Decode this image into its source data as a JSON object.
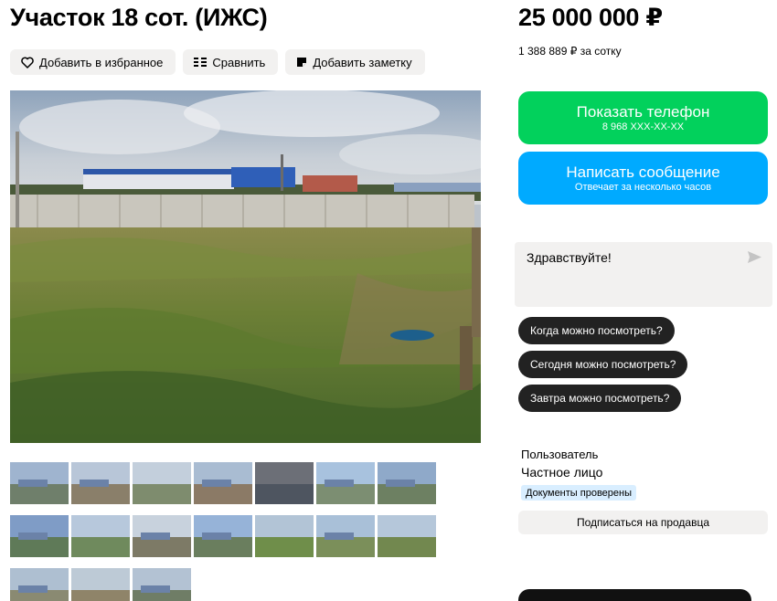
{
  "listing": {
    "title": "Участок 18 сот. (ИЖС)",
    "price": "25 000 000 ₽",
    "price_per_unit": "1 388 889 ₽ за сотку"
  },
  "actions": {
    "favorite": "Добавить в избранное",
    "compare": "Сравнить",
    "note": "Добавить заметку"
  },
  "contact": {
    "show_phone": "Показать телефон",
    "phone_masked": "8 968 XXX-XX-XX",
    "write_message": "Написать сообщение",
    "reply_time": "Отвечает за несколько часов"
  },
  "chat": {
    "draft_text": "Здравствуйте!",
    "quick_replies": [
      "Когда можно посмотреть?",
      "Сегодня можно посмотреть?",
      "Завтра можно посмотреть?"
    ]
  },
  "seller": {
    "role": "Пользователь",
    "type": "Частное лицо",
    "verified_badge": "Документы проверены",
    "subscribe": "Подписаться на продавца"
  },
  "gallery": {
    "thumbnail_count": 17,
    "active_index": 11,
    "thumbs": [
      {
        "sky": "#9fb4cf",
        "ground": "#6f7f6b",
        "building": true
      },
      {
        "sky": "#b8c6d8",
        "ground": "#8a7f6a",
        "building": true
      },
      {
        "sky": "#c3cfdc",
        "ground": "#7e8c6e",
        "building": false
      },
      {
        "sky": "#a9bcd2",
        "ground": "#8b7a66",
        "building": true
      },
      {
        "sky": "#6c6f77",
        "ground": "#4e5560",
        "building": false
      },
      {
        "sky": "#a8c2de",
        "ground": "#7c8e72",
        "building": true
      },
      {
        "sky": "#8fa9c9",
        "ground": "#6d8062",
        "building": true
      },
      {
        "sky": "#7f9cc6",
        "ground": "#5f7a58",
        "building": true
      },
      {
        "sky": "#b7c8dc",
        "ground": "#6f8a5d",
        "building": false
      },
      {
        "sky": "#c8d2dd",
        "ground": "#7d7a66",
        "building": true
      },
      {
        "sky": "#96b3d8",
        "ground": "#6a7e5e",
        "building": true
      },
      {
        "sky": "#b2c4d6",
        "ground": "#6f8e4a",
        "building": false
      },
      {
        "sky": "#a9c0d8",
        "ground": "#7b8f5a",
        "building": true
      },
      {
        "sky": "#b5c7da",
        "ground": "#72884f",
        "building": false
      },
      {
        "sky": "#aebfd1",
        "ground": "#8a8a72",
        "building": true
      },
      {
        "sky": "#bdcad6",
        "ground": "#8f8469",
        "building": false
      },
      {
        "sky": "#b3c2d3",
        "ground": "#6f7d66",
        "building": true
      }
    ]
  },
  "icons": {
    "favorite": "heart-icon",
    "compare": "compare-icon",
    "note": "note-icon",
    "send": "send-icon"
  },
  "colors": {
    "phone_button": "#02d15c",
    "message_button": "#00aaff",
    "active_thumb_border": "#22a7f0",
    "chip_bg": "#f2f1f0",
    "pill_bg": "#222222",
    "badge_bg": "#d9eeff"
  }
}
